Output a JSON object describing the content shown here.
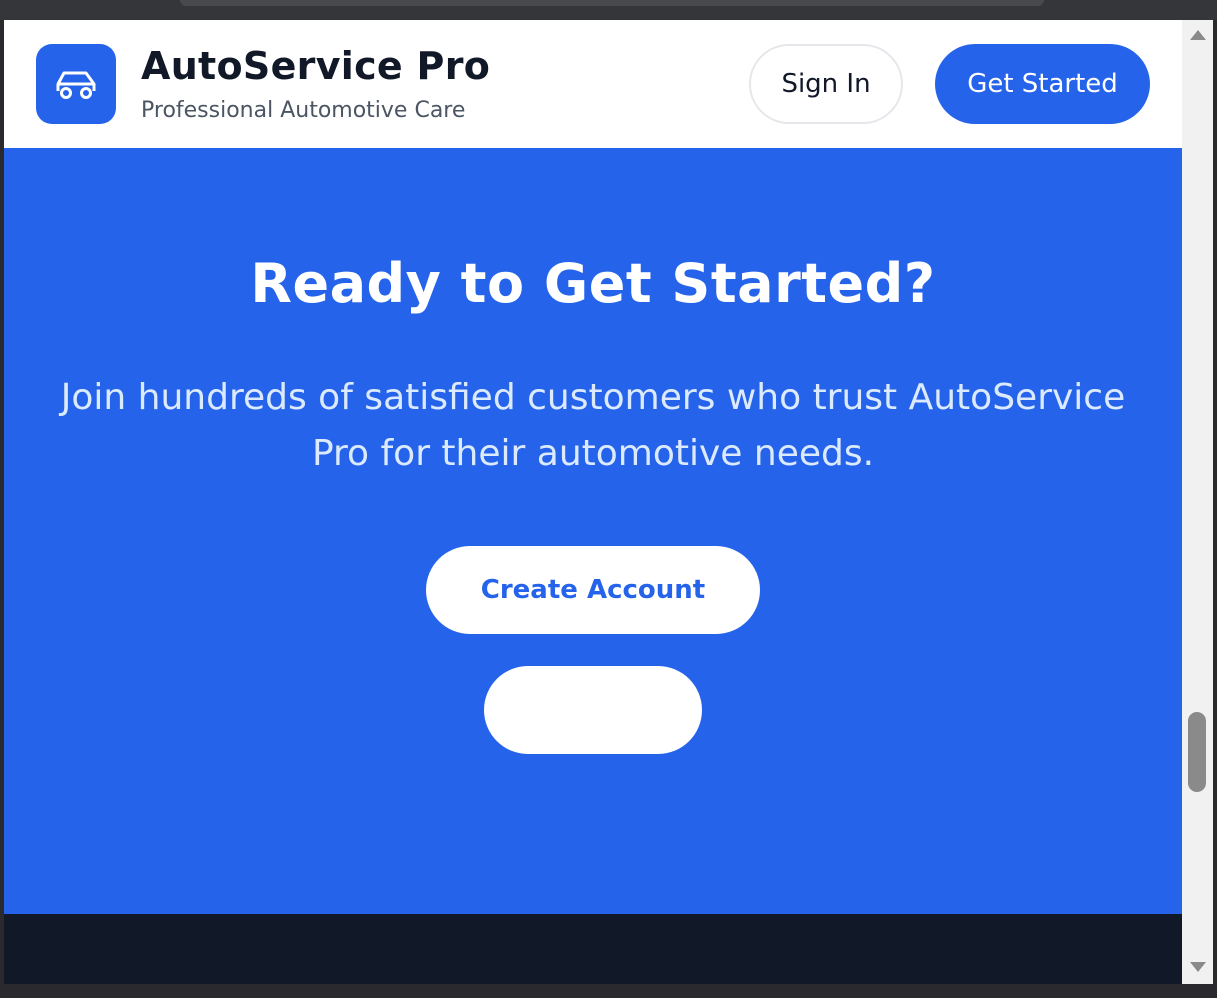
{
  "header": {
    "brand_title": "AutoService Pro",
    "brand_subtitle": "Professional Automotive Care",
    "logo_icon": "car-icon",
    "signin_label": "Sign In",
    "getstarted_label": "Get Started"
  },
  "cta": {
    "title": "Ready to Get Started?",
    "text": "Join hundreds of satisfied customers who trust AutoService Pro for their automotive needs.",
    "create_account_label": "Create Account",
    "secondary_label": ""
  },
  "colors": {
    "primary": "#2563eb",
    "footer": "#111827",
    "cta_text": "#dbeafe"
  }
}
